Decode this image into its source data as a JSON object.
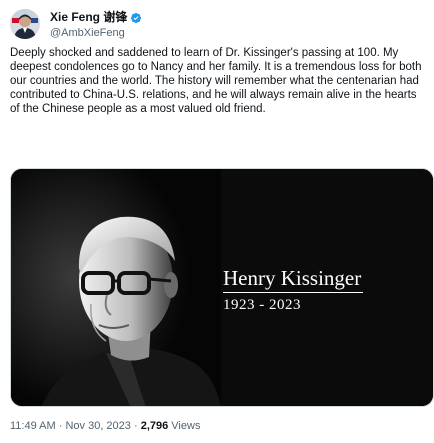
{
  "author": {
    "display_name": "Xie Feng 谢锋",
    "handle": "@AmbXieFeng",
    "verified_icon": "verified-badge-icon",
    "verified_color": "#1d9bf0"
  },
  "tweet": {
    "text": "Deeply shocked and saddened to learn of Dr. Kissinger's passing at 100. My deepest condolences go to Nancy and her family. It is a tremendous loss for both our countries and the world. The history will remember what the centenarian had contributed to China-U.S. relations, and he will always remain alive in the hearts of the Chinese people as a most valued old friend."
  },
  "media": {
    "name": "Henry Kissinger",
    "years": "1923 - 2023"
  },
  "meta": {
    "time": "11:49 AM",
    "separator1": "·",
    "date": "Nov 30, 2023",
    "separator2": "·",
    "views_count": "2,796",
    "views_label": "Views"
  }
}
